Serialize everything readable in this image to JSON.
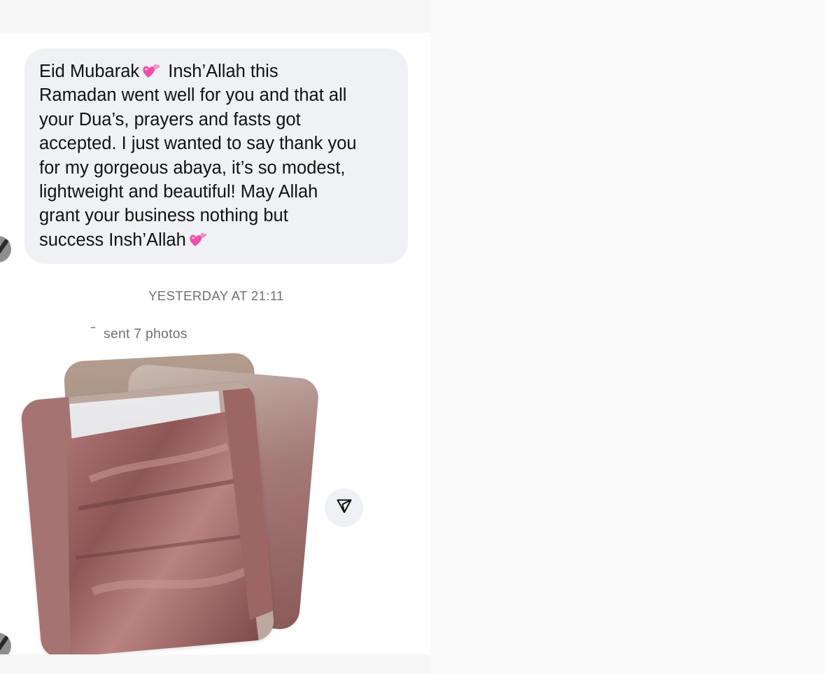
{
  "message": {
    "line_1_before_emoji": "Eid Mubarak",
    "line_1_after_emoji": "Insh’Allah this",
    "line_2": "Ramadan went well for you and that all",
    "line_3": "your Dua’s, prayers and fasts got",
    "line_4": "accepted. I just wanted to say thank you",
    "line_5": "for my gorgeous abaya, it’s so modest,",
    "line_6": "lightweight and beautiful! May Allah",
    "line_7": "grant your business nothing but",
    "line_8": "success Insh’Allah",
    "emoji": "two-hearts-emoji"
  },
  "timestamp": "YESTERDAY AT 21:11",
  "photos_notice": {
    "text": "sent 7 photos"
  },
  "icons": {
    "share": "send-icon",
    "avatar": "avatar-icon"
  },
  "colors": {
    "bubble": "#eff1f4",
    "heart": "#f04fa6",
    "meta_text": "#6f6f73"
  }
}
